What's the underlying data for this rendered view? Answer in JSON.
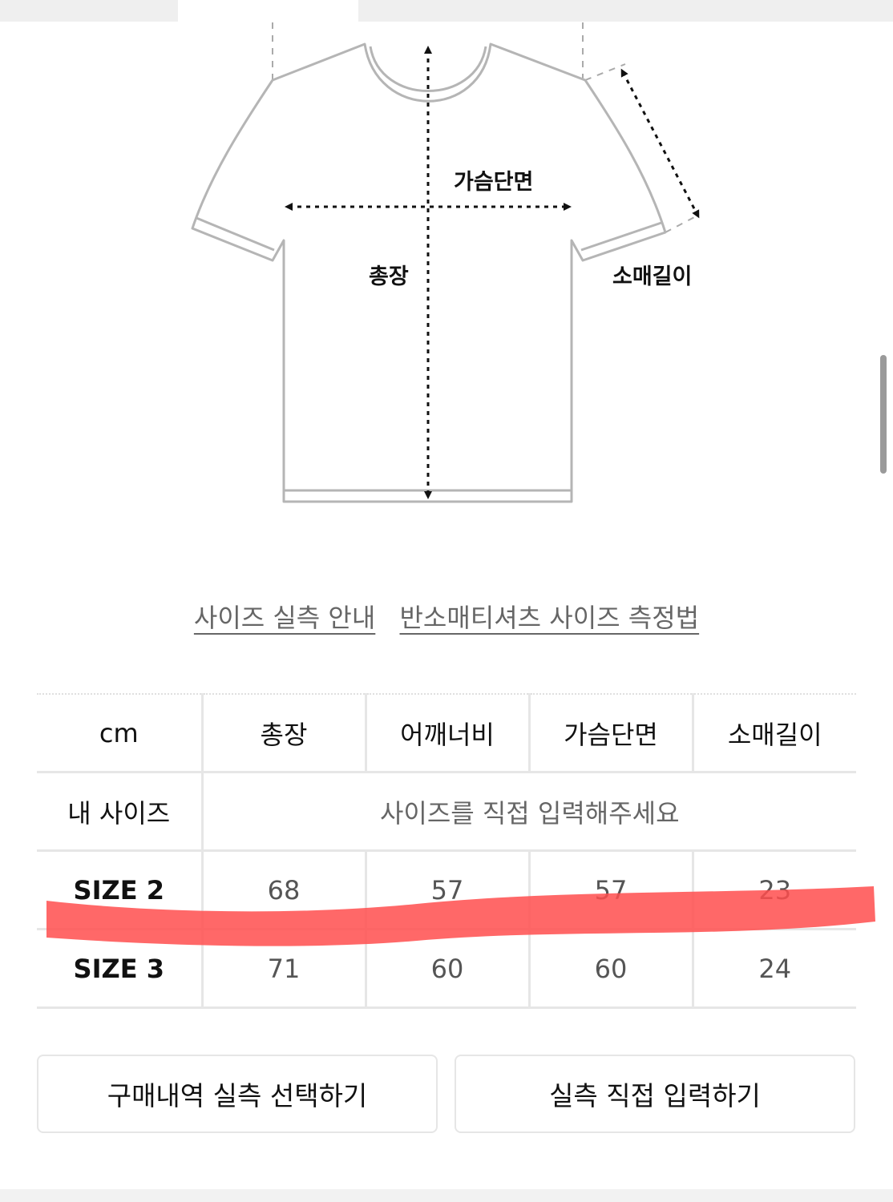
{
  "diagram": {
    "chest_label": "가슴단면",
    "length_label": "총장",
    "sleeve_label": "소매길이"
  },
  "links": {
    "size_guide": "사이즈 실측 안내",
    "measure_method": "반소매티셔츠 사이즈 측정법"
  },
  "table": {
    "headers": [
      "cm",
      "총장",
      "어깨너비",
      "가슴단면",
      "소매길이"
    ],
    "my_size_label": "내 사이즈",
    "my_size_hint": "사이즈를 직접 입력해주세요",
    "rows": [
      {
        "label": "SIZE 2",
        "values": [
          "68",
          "57",
          "57",
          "23"
        ]
      },
      {
        "label": "SIZE 3",
        "values": [
          "71",
          "60",
          "60",
          "24"
        ]
      }
    ]
  },
  "buttons": {
    "select_from_purchases": "구매내역 실측 선택하기",
    "enter_manually": "실측 직접 입력하기"
  },
  "colors": {
    "highlight": "#ff4d4d",
    "border": "#e6e6e6"
  }
}
